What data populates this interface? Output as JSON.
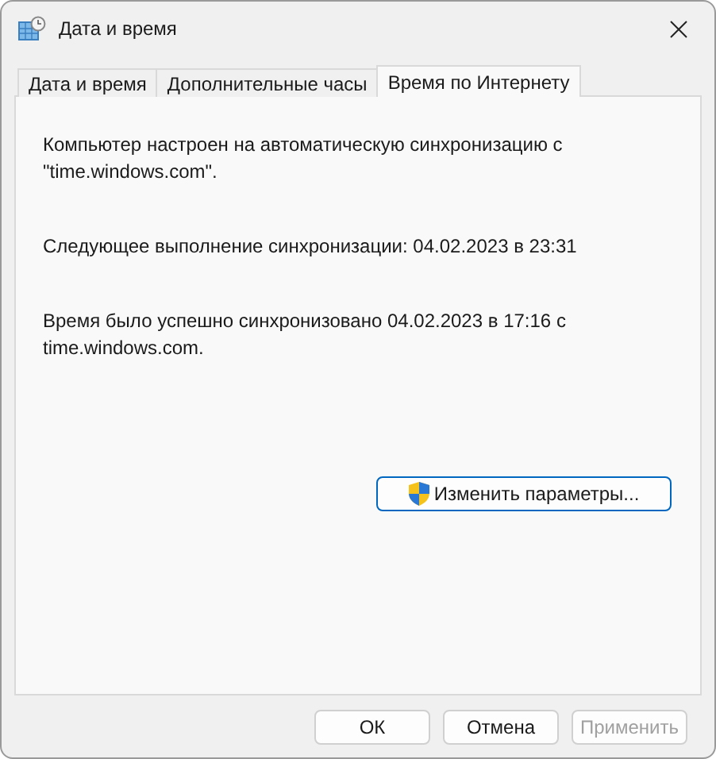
{
  "window": {
    "title": "Дата и время"
  },
  "tabs": [
    {
      "label": "Дата и время",
      "selected": false
    },
    {
      "label": "Дополнительные часы",
      "selected": false
    },
    {
      "label": "Время по Интернету",
      "selected": true
    }
  ],
  "paragraphs": [
    "Компьютер настроен на автоматическую синхронизацию с \"time.windows.com\".",
    "Следующее выполнение синхронизации: 04.02.2023 в 23:31",
    "Время было успешно синхронизовано 04.02.2023 в 17:16 с time.windows.com."
  ],
  "change_button": {
    "label": "Изменить параметры..."
  },
  "buttons": [
    {
      "label": "ОК",
      "disabled": false
    },
    {
      "label": "Отмена",
      "disabled": false
    },
    {
      "label": "Применить",
      "disabled": true
    }
  ]
}
